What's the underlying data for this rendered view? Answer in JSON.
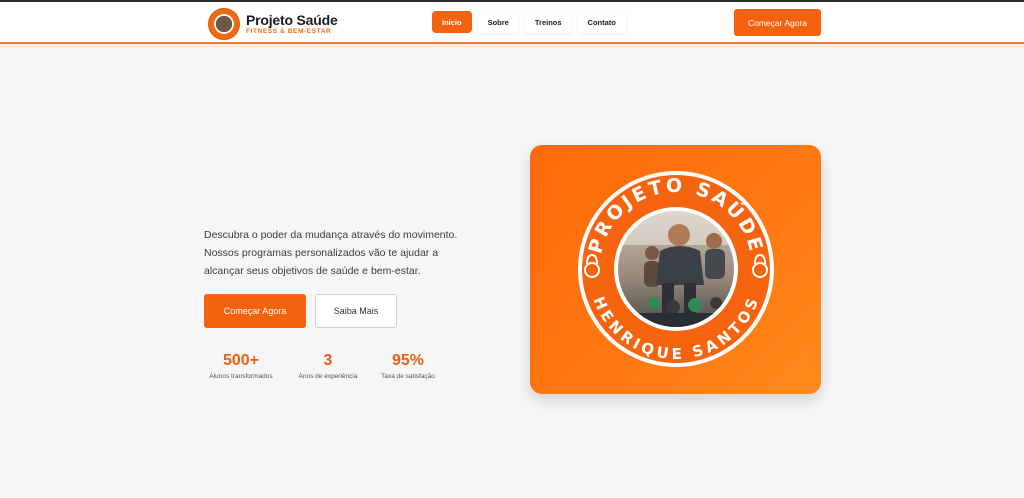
{
  "header": {
    "brand_title": "Projeto Saúde",
    "brand_subtitle": "FITNESS & BEM-ESTAR",
    "nav": [
      {
        "label": "Início",
        "active": true
      },
      {
        "label": "Sobre",
        "active": false
      },
      {
        "label": "Treinos",
        "active": false
      },
      {
        "label": "Contato",
        "active": false
      }
    ],
    "cta_label": "Começar Agora"
  },
  "hero": {
    "description_lines": [
      "Descubra o poder da mudança através do movimento.",
      "Nossos programas personalizados vão te ajudar a",
      "alcançar seus objetivos de saúde e bem-estar."
    ],
    "primary_button": "Começar Agora",
    "secondary_button": "Saiba Mais",
    "stats": [
      {
        "value": "500+",
        "label": "Alunos transformados"
      },
      {
        "value": "3",
        "label": "Anos de experiência"
      },
      {
        "value": "95%",
        "label": "Taxa de satisfação"
      }
    ],
    "badge": {
      "top_text": "PROJETO SAÚDE",
      "bottom_text": "HENRIQUE SANTOS"
    }
  },
  "colors": {
    "accent": "#f5620f",
    "card_gradient_start": "#ff6a0a",
    "card_gradient_end": "#ff8a1c"
  },
  "icons": [
    "logo-badge-icon",
    "kettlebell-icon"
  ]
}
